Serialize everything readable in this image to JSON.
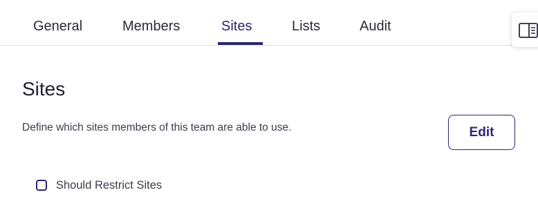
{
  "tabs": [
    {
      "label": "General",
      "active": false
    },
    {
      "label": "Members",
      "active": false
    },
    {
      "label": "Sites",
      "active": true
    },
    {
      "label": "Lists",
      "active": false
    },
    {
      "label": "Audit",
      "active": false
    }
  ],
  "section": {
    "title": "Sites",
    "description": "Define which sites members of this team are able to use.",
    "edit_label": "Edit"
  },
  "restrict_checkbox": {
    "label": "Should Restrict Sites",
    "checked": false
  },
  "icons": {
    "panel_toggle": "sidebar-panel-icon"
  },
  "colors": {
    "accent": "#2c2670",
    "divider": "#dcdce3"
  }
}
